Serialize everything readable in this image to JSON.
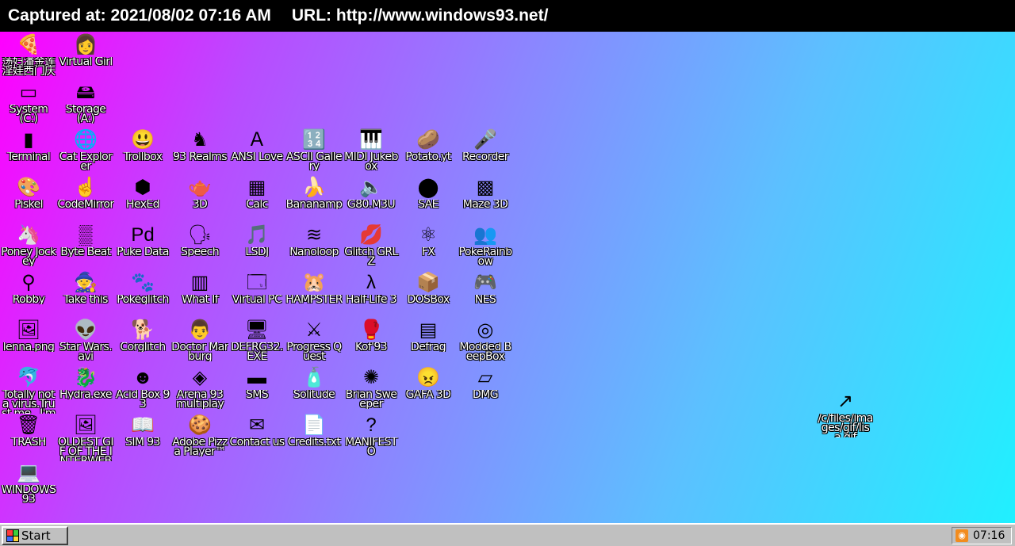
{
  "capture": {
    "captured_text": "Captured at: 2021/08/02 07:16 AM",
    "url_text": "URL: http://www.windows93.net/"
  },
  "desktop": {
    "icons": [
      {
        "label": "荡妇潘金莲淫娃西门庆",
        "icon": "pizza-icon",
        "glyph": "🍕"
      },
      {
        "label": "Virtual Girl",
        "icon": "girl-face-icon",
        "glyph": "👩"
      },
      {
        "label": "System (C:)",
        "icon": "drive-icon",
        "glyph": "▭"
      },
      {
        "label": "Storage (A:)",
        "icon": "floppy-drive-icon",
        "glyph": "🖴"
      },
      {
        "label": "Terminal",
        "icon": "terminal-icon",
        "glyph": "▮"
      },
      {
        "label": "Cat Explorer",
        "icon": "cat-globe-icon",
        "glyph": "🌐"
      },
      {
        "label": "Trollbox",
        "icon": "chat-smiley-icon",
        "glyph": "😃"
      },
      {
        "label": "93 Realms",
        "icon": "knight-icon",
        "glyph": "♞"
      },
      {
        "label": "ANSI Love",
        "icon": "letter-a-icon",
        "glyph": "Ａ"
      },
      {
        "label": "ASCII Gallery",
        "icon": "ascii-123-icon",
        "glyph": "🔢"
      },
      {
        "label": "MIDI Jukebox",
        "icon": "piano-keys-icon",
        "glyph": "🎹"
      },
      {
        "label": "Potato.yt",
        "icon": "potato-icon",
        "glyph": "🥔"
      },
      {
        "label": "Recorder",
        "icon": "microphone-icon",
        "glyph": "🎤"
      },
      {
        "label": "Piskel",
        "icon": "palette-icon",
        "glyph": "🎨"
      },
      {
        "label": "CodeMirror",
        "icon": "hand-cursor-icon",
        "glyph": "☝"
      },
      {
        "label": "HexEd",
        "icon": "cube-icon",
        "glyph": "⬢"
      },
      {
        "label": "3D",
        "icon": "teapot-icon",
        "glyph": "🫖"
      },
      {
        "label": "Calc",
        "icon": "calculator-icon",
        "glyph": "▦"
      },
      {
        "label": "Bananamp",
        "icon": "banana-icon",
        "glyph": "🍌"
      },
      {
        "label": "G80.M3U",
        "icon": "audio-file-icon",
        "glyph": "🔈"
      },
      {
        "label": "SAE",
        "icon": "amiga-ball-icon",
        "glyph": "⬤"
      },
      {
        "label": "Maze 3D",
        "icon": "maze-icon",
        "glyph": "▩"
      },
      {
        "label": "Poney Jockey",
        "icon": "pony-icon",
        "glyph": "🦄"
      },
      {
        "label": "Byte Beat",
        "icon": "wave-icon",
        "glyph": "▒"
      },
      {
        "label": "Puke Data",
        "icon": "pd-icon",
        "glyph": "Pd"
      },
      {
        "label": "Speech",
        "icon": "face-speech-icon",
        "glyph": "🗣"
      },
      {
        "label": "LSDJ",
        "icon": "gameboy-music-icon",
        "glyph": "🎵"
      },
      {
        "label": "Nanoloop",
        "icon": "loop-icon",
        "glyph": "≋"
      },
      {
        "label": "Glitch GRLZ",
        "icon": "lips-icon",
        "glyph": "💋"
      },
      {
        "label": "FX",
        "icon": "atom-icon",
        "glyph": "⚛"
      },
      {
        "label": "PokeRainbow",
        "icon": "pokemon-trainers-icon",
        "glyph": "👥"
      },
      {
        "label": "Robby",
        "icon": "stick-figure-icon",
        "glyph": "⚲"
      },
      {
        "label": "Take this",
        "icon": "old-man-icon",
        "glyph": "🧙"
      },
      {
        "label": "Pokéglitch",
        "icon": "pokeglitch-icon",
        "glyph": "🐾"
      },
      {
        "label": "What If",
        "icon": "chart-icon",
        "glyph": "▥"
      },
      {
        "label": "Virtual PC",
        "icon": "window-icon",
        "glyph": "🗔"
      },
      {
        "label": "HAMPSTER",
        "icon": "hamster-icon",
        "glyph": "🐹"
      },
      {
        "label": "Half-Life 3",
        "icon": "lambda-icon",
        "glyph": "λ"
      },
      {
        "label": "DOSBox",
        "icon": "dosbox-icon",
        "glyph": "📦"
      },
      {
        "label": "NES",
        "icon": "nes-console-icon",
        "glyph": "🎮"
      },
      {
        "label": "lenna.png",
        "icon": "image-file-icon",
        "glyph": "🖼"
      },
      {
        "label": "Star Wars.avi",
        "icon": "yoda-icon",
        "glyph": "👽"
      },
      {
        "label": "Corglitch",
        "icon": "corgi-icon",
        "glyph": "🐕"
      },
      {
        "label": "Doctor Marburg",
        "icon": "doctor-icon",
        "glyph": "👨"
      },
      {
        "label": "DEFRG32.EXE",
        "icon": "monitor-face-icon",
        "glyph": "🖥"
      },
      {
        "label": "Progress Quest",
        "icon": "crossed-swords-icon",
        "glyph": "⚔"
      },
      {
        "label": "Kof'93",
        "icon": "fighter-icon",
        "glyph": "🥊"
      },
      {
        "label": "Defrag",
        "icon": "defrag-icon",
        "glyph": "▤"
      },
      {
        "label": "Modded BeepBox",
        "icon": "beepbox-icon",
        "glyph": "◎"
      },
      {
        "label": "Totally not a virus.Trust me...I'm a dolphin",
        "icon": "dolphin-icon",
        "glyph": "🐬"
      },
      {
        "label": "Hydra.exe",
        "icon": "dragon-icon",
        "glyph": "🐉"
      },
      {
        "label": "Acid Box 93",
        "icon": "smiley-icon",
        "glyph": "☻"
      },
      {
        "label": "Arena 93 multiplay",
        "icon": "iso-cube-icon",
        "glyph": "◈"
      },
      {
        "label": "SMS",
        "icon": "sega-console-icon",
        "glyph": "▬"
      },
      {
        "label": "Solitude",
        "icon": "bottle-icon",
        "glyph": "🧴"
      },
      {
        "label": "Brian Sweeper",
        "icon": "mine-icon",
        "glyph": "✺"
      },
      {
        "label": "GAFA 3D",
        "icon": "doom-face-icon",
        "glyph": "😠"
      },
      {
        "label": "DMG",
        "icon": "gameboy-cartridge-icon",
        "glyph": "▱"
      },
      {
        "label": "TRASH",
        "icon": "recycle-bin-icon",
        "glyph": "🗑"
      },
      {
        "label": "OLDEST GIF OF THE INTERWEBZ.gif",
        "icon": "gif-file-icon",
        "glyph": "🖼"
      },
      {
        "label": "SIM 93",
        "icon": "book-icon",
        "glyph": "📖"
      },
      {
        "label": "Adobe Pizza Player™",
        "icon": "pizza-player-icon",
        "glyph": "🍪"
      },
      {
        "label": "Contact us",
        "icon": "contact-icon",
        "glyph": "✉"
      },
      {
        "label": "Credits.txt",
        "icon": "text-file-icon",
        "glyph": "📄"
      },
      {
        "label": "MANIFESTO",
        "icon": "question-mark-icon",
        "glyph": "?"
      },
      {
        "label": "WINDOWS 93",
        "icon": "computer-icon",
        "glyph": "💻"
      },
      {
        "label": "/c/files/images/gif/lisa.gif",
        "icon": "shortcut-file-icon",
        "glyph": "↗"
      }
    ]
  },
  "taskbar": {
    "start_label": "Start",
    "clock": "07:16",
    "tray_icon": "rss-icon"
  },
  "colors": {
    "desktop_gradient": [
      "#ff00ff",
      "#8b86ff",
      "#20f0ff"
    ],
    "taskbar": "#c0c0c0"
  }
}
